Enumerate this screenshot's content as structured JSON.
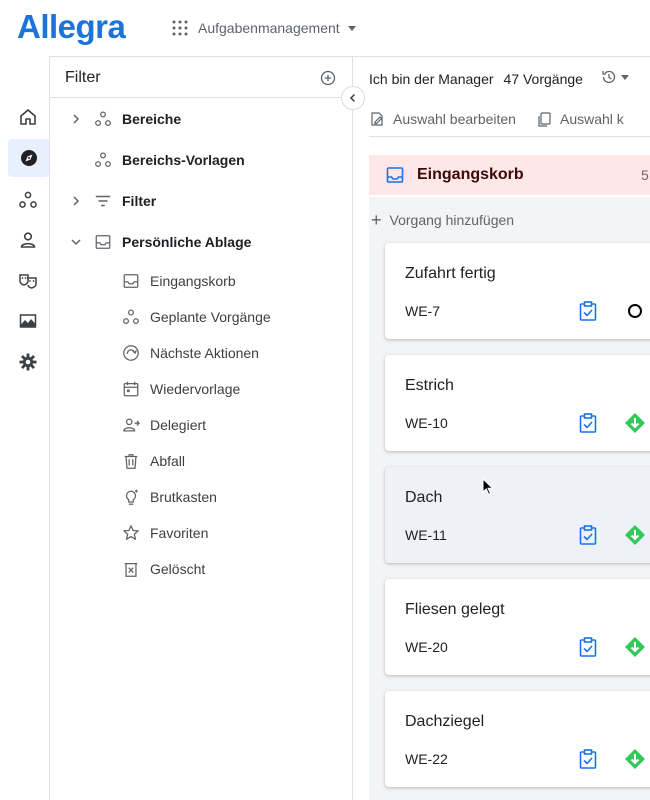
{
  "header": {
    "logo": "Allegra",
    "app_switcher_label": "Aufgabenmanagement"
  },
  "rail": {
    "items": [
      {
        "icon": "home-icon"
      },
      {
        "icon": "compass-icon",
        "active": true
      },
      {
        "icon": "areas-icon"
      },
      {
        "icon": "person-icon"
      },
      {
        "icon": "theater-masks-icon"
      },
      {
        "icon": "landscape-icon"
      },
      {
        "icon": "gear-icon"
      }
    ]
  },
  "filter_panel": {
    "title": "Filter",
    "tree": [
      {
        "label": "Bereiche",
        "icon": "areas-icon",
        "expandable": true,
        "expanded": false
      },
      {
        "label": "Bereichs-Vorlagen",
        "icon": "areas-icon",
        "expandable": false
      },
      {
        "label": "Filter",
        "icon": "filter-icon",
        "expandable": true,
        "expanded": false
      },
      {
        "label": "Persönliche Ablage",
        "icon": "inbox-icon",
        "expandable": true,
        "expanded": true
      }
    ],
    "personal_items": [
      {
        "label": "Eingangskorb",
        "icon": "inbox-icon"
      },
      {
        "label": "Geplante Vorgänge",
        "icon": "areas-icon"
      },
      {
        "label": "Nächste Aktionen",
        "icon": "refresh-arrow-icon"
      },
      {
        "label": "Wiedervorlage",
        "icon": "calendar-icon"
      },
      {
        "label": "Delegiert",
        "icon": "delegate-person-icon"
      },
      {
        "label": "Abfall",
        "icon": "trash-icon"
      },
      {
        "label": "Brutkasten",
        "icon": "lightbulb-icon"
      },
      {
        "label": "Favoriten",
        "icon": "star-icon"
      },
      {
        "label": "Gelöscht",
        "icon": "deleted-icon"
      }
    ]
  },
  "main": {
    "title": "Ich bin der Manager",
    "count": "47 Vorgänge",
    "toolbar": {
      "edit_selection": "Auswahl bearbeiten",
      "copy_selection": "Auswahl k"
    },
    "inbox": {
      "title": "Eingangskorb",
      "count": "5",
      "add_task": "Vorgang hinzufügen"
    },
    "cards": [
      {
        "title": "Zufahrt fertig",
        "id": "WE-7",
        "state": "open-circle"
      },
      {
        "title": "Estrich",
        "id": "WE-10",
        "state": "green-down-arrow"
      },
      {
        "title": "Dach",
        "id": "WE-11",
        "state": "green-down-arrow",
        "hovered": true
      },
      {
        "title": "Fliesen gelegt",
        "id": "WE-20",
        "state": "green-down-arrow"
      },
      {
        "title": "Dachziegel",
        "id": "WE-22",
        "state": "green-down-arrow"
      }
    ]
  },
  "colors": {
    "brand": "#1d74d8",
    "inbox_header_bg": "#fde7e7",
    "clipboard_blue": "#1a73e8",
    "state_green": "#34c759",
    "rail_active_bg": "#e8f0fe"
  }
}
